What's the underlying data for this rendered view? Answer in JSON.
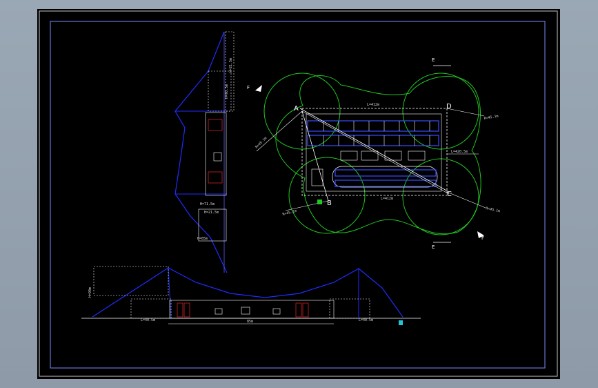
{
  "plan_view": {
    "point_labels": {
      "a": "A",
      "b": "B",
      "c": "C",
      "d": "D"
    },
    "section_labels": {
      "e_top": "E",
      "e_bottom": "E",
      "f_top": "F",
      "f_bottom": "F"
    },
    "dims": {
      "top_length": "L=412m",
      "bottom_length": "L=412m",
      "right_mid": "L=420.5m",
      "diag_ul": "R=45.1m",
      "diag_ll": "R=45.1m",
      "diag_ur": "R=45.1m",
      "diag_lr": "R=45.1m"
    }
  },
  "side_view": {
    "dims": {
      "top": "H=21.5m",
      "mid1": "H=90.5m",
      "mid2": "H=71.5m",
      "mid3": "H=21.5m",
      "bottom": "H=85m"
    }
  },
  "front_view": {
    "dims": {
      "left": "L=40.5m",
      "center": "85m",
      "right": "L=40.5m",
      "height": "H=90m"
    }
  },
  "colors": {
    "frame": "#7a8cff",
    "cable": "#1f2dff",
    "green": "#22c522",
    "white": "#ffffff"
  }
}
